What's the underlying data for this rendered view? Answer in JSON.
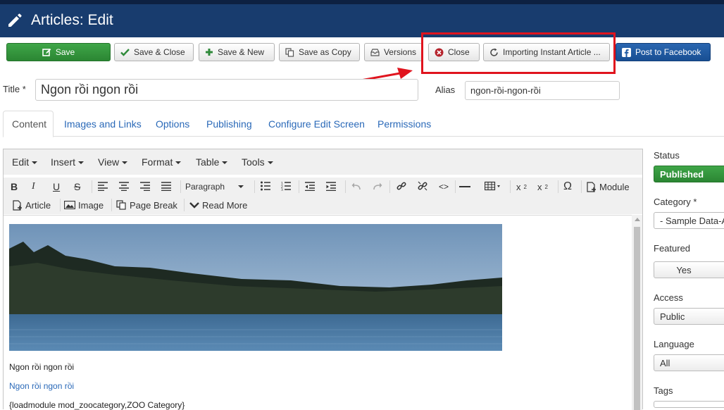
{
  "header": {
    "title": "Articles: Edit"
  },
  "toolbar": {
    "save": "Save",
    "save_close": "Save & Close",
    "save_new": "Save & New",
    "save_copy": "Save as Copy",
    "versions": "Versions",
    "close": "Close",
    "importing": "Importing Instant Article ...",
    "post_facebook": "Post to Facebook"
  },
  "form": {
    "title_label": "Title *",
    "title_value": "Ngon rồi ngon rồi",
    "alias_label": "Alias",
    "alias_value": "ngon-rồi-ngon-rồi"
  },
  "tabs": [
    "Content",
    "Images and Links",
    "Options",
    "Publishing",
    "Configure Edit Screen",
    "Permissions"
  ],
  "editor": {
    "menus": [
      "Edit",
      "Insert",
      "View",
      "Format",
      "Table",
      "Tools"
    ],
    "format_select": "Paragraph",
    "buttons": {
      "module": "Module",
      "article": "Article",
      "image": "Image",
      "page_break": "Page Break",
      "read_more": "Read More"
    },
    "paragraphs": [
      "Ngon rồi ngon rồi",
      "Ngon rồi ngon rồi",
      "{loadmodule mod_zoocategory,ZOO Category}"
    ]
  },
  "sidebar": {
    "status_label": "Status",
    "status_value": "Published",
    "category_label": "Category *",
    "category_value": "- Sample Data-A",
    "featured_label": "Featured",
    "featured_value": "Yes",
    "access_label": "Access",
    "access_value": "Public",
    "language_label": "Language",
    "language_value": "All",
    "tags_label": "Tags"
  },
  "colors": {
    "header_bg": "#183c6e",
    "save_green": "#2f9a3a",
    "link_blue": "#2a69b8",
    "annotation_red": "#e0141e",
    "facebook_blue": "#1f5aa3"
  }
}
